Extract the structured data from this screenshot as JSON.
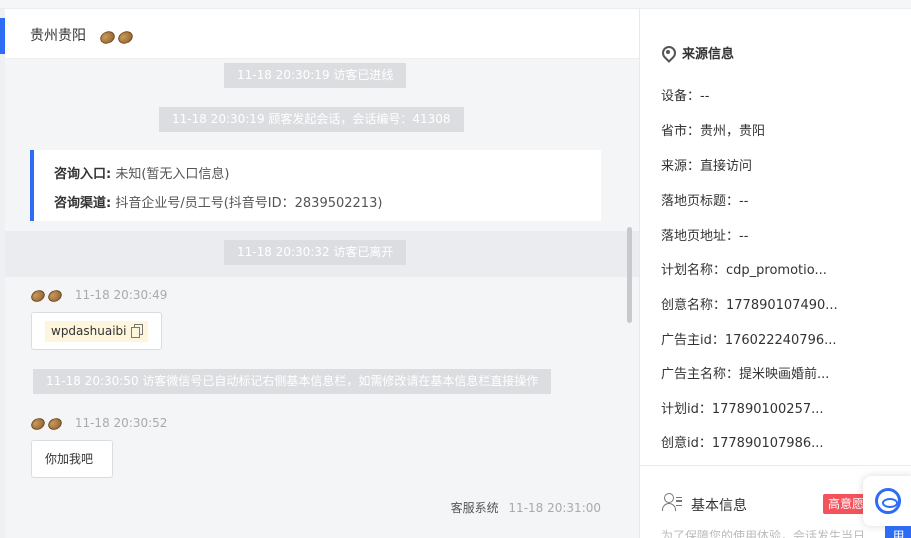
{
  "chat": {
    "title": "贵州贵阳",
    "system_msgs": [
      "11-18 20:30:19 访客已进线",
      "11-18 20:30:19 顾客发起会话，会话编号：41308",
      "11-18 20:30:32 访客已离开",
      "11-18 20:30:50 访客微信号已自动标记右侧基本信息栏，如需修改请在基本信息栏直接操作"
    ],
    "card": {
      "entry_label": "咨询入口:",
      "entry_value": "未知(暂无入口信息)",
      "channel_label": "咨询渠道:",
      "channel_value": "抖音企业号/员工号(抖音号ID：2839502213)"
    },
    "messages": [
      {
        "time": "11-18 20:30:49",
        "text": "wpdashuaibi"
      },
      {
        "time": "11-18 20:30:52",
        "text": "你加我吧"
      }
    ],
    "sent": {
      "sender": "客服系统",
      "time": "11-18 20:31:00"
    }
  },
  "sidebar": {
    "section_title": "来源信息",
    "rows": [
      "设备：--",
      "省市：贵州，贵阳",
      "来源：直接访问",
      "落地页标题：--",
      "落地页地址：--",
      "计划名称：cdp_promotio...",
      "创意名称：177890107490...",
      "广告主id：176022240796...",
      "广告主名称：提米映画婚前...",
      "计划id：177890100257...",
      "创意id：177890107986..."
    ],
    "basic_info": "基本信息",
    "badge": "高意愿",
    "tip": "为了保障您的使用体验，会话发生当日",
    "blue_btn": "用"
  }
}
